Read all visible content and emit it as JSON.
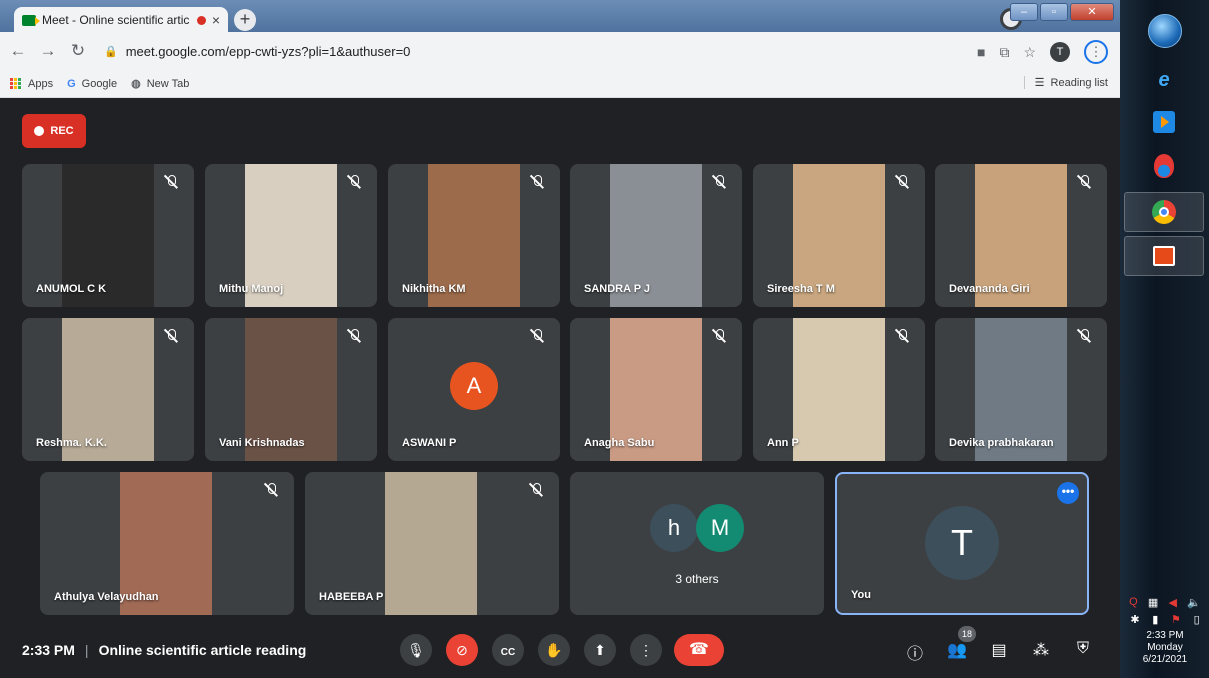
{
  "browser": {
    "tab_title": "Meet - Online scientific artic",
    "tab_close": "×",
    "new_tab": "+",
    "url": "meet.google.com/epp-cwti-yzs?pli=1&authuser=0",
    "profile_initial": "T",
    "bookmarks": [
      {
        "label": "Apps",
        "icon": "apps-grid-icon"
      },
      {
        "label": "Google",
        "icon": "google-g-icon"
      },
      {
        "label": "New Tab",
        "icon": "globe-icon"
      }
    ],
    "reading_list": "Reading list"
  },
  "meet": {
    "rec_label": "REC",
    "participants": [
      {
        "name": "ANUMOL C K",
        "muted": true,
        "bg": "#2b2a2a"
      },
      {
        "name": "Mithu Manoj",
        "muted": true,
        "bg": "#d8cfc0"
      },
      {
        "name": "Nikhitha KM",
        "muted": true,
        "bg": "#9c6b4b"
      },
      {
        "name": "SANDRA P J",
        "muted": true,
        "bg": "#8a8f95"
      },
      {
        "name": "Sireesha T M",
        "muted": true,
        "bg": "#c9a67f"
      },
      {
        "name": "Devananda Giri",
        "muted": true,
        "bg": "#c8a27a"
      },
      {
        "name": "Reshma. K.K.",
        "muted": true,
        "bg": "#b7aa96"
      },
      {
        "name": "Vani Krishnadas",
        "muted": true,
        "bg": "#6b5246"
      },
      {
        "name": "ASWANI P",
        "muted": true,
        "initial": "A",
        "color": "#e8541f"
      },
      {
        "name": "Anagha Sabu",
        "muted": true,
        "bg": "#c99b85"
      },
      {
        "name": "Ann P",
        "muted": true,
        "bg": "#d6c9b0"
      },
      {
        "name": "Devika prabhakaran",
        "muted": true,
        "bg": "#6f7a85"
      },
      {
        "name": "Athulya Velayudhan",
        "muted": true,
        "bg": "#a06a55"
      },
      {
        "name": "HABEEBA P",
        "muted": true,
        "bg": "#b5a892"
      }
    ],
    "others": {
      "label": "3 others",
      "initials": [
        "h",
        "M"
      ],
      "colors": [
        "#3c4f5a",
        "#138a72"
      ]
    },
    "you": {
      "name": "You",
      "initial": "T",
      "color": "#3c4f5a",
      "more": "•••"
    }
  },
  "bottom_bar": {
    "time": "2:33 PM",
    "meeting_title": "Online scientific article reading",
    "people_count": "18"
  },
  "taskbar": {
    "clock_time": "2:33 PM",
    "clock_day": "Monday",
    "clock_date": "6/21/2021"
  }
}
